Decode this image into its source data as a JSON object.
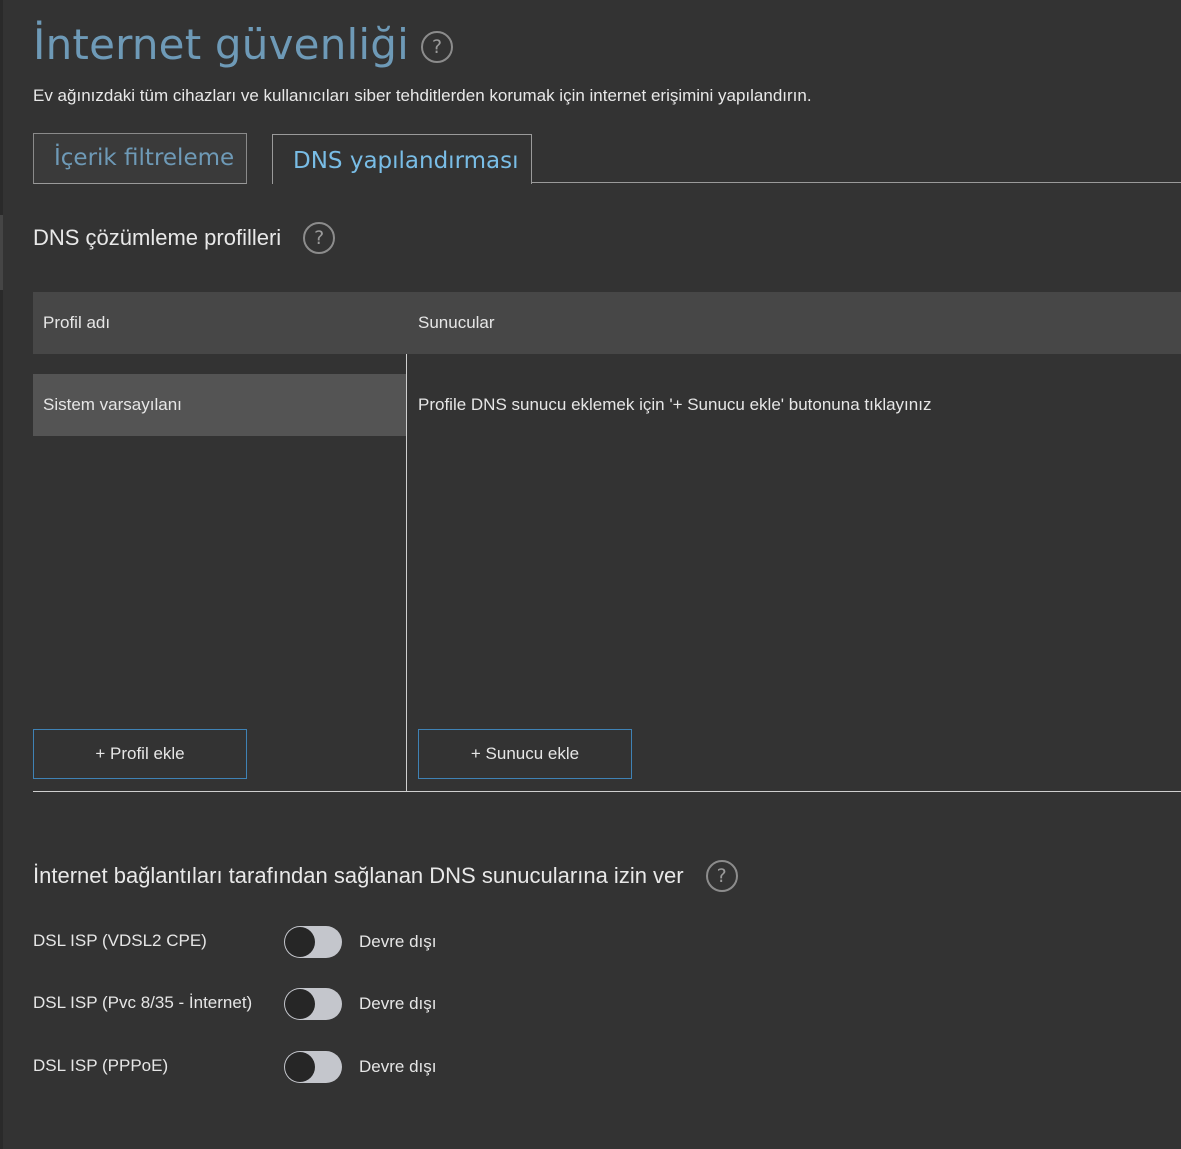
{
  "page": {
    "title": "İnternet güvenliği",
    "subtitle": "Ev ağınızdaki tüm cihazları ve kullanıcıları siber tehditlerden korumak için internet erişimini yapılandırın.",
    "help_glyph": "?"
  },
  "tabs": [
    {
      "label": "İçerik filtreleme",
      "active": false
    },
    {
      "label": "DNS yapılandırması",
      "active": true
    }
  ],
  "dns_profiles": {
    "title": "DNS çözümleme profilleri",
    "columns": [
      "Profil adı",
      "Sunucular"
    ],
    "profiles": [
      {
        "name": "Sistem varsayılanı",
        "selected": true
      }
    ],
    "servers_hint": "Profile DNS sunucu eklemek için '+ Sunucu ekle' butonuna tıklayınız",
    "add_profile_label": "+ Profil ekle",
    "add_server_label": "+ Sunucu ekle"
  },
  "isp_dns": {
    "title": "İnternet bağlantıları tarafından sağlanan DNS sunucularına izin ver",
    "connections": [
      {
        "label": "DSL ISP (VDSL2 CPE)",
        "state": "Devre dışı",
        "enabled": false
      },
      {
        "label": "DSL ISP (Pvc 8/35 - İnternet)",
        "state": "Devre dışı",
        "enabled": false
      },
      {
        "label": "DSL ISP (PPPoE)",
        "state": "Devre dışı",
        "enabled": false
      }
    ]
  },
  "colors": {
    "background": "#333333",
    "title_blue": "#6e9ab7",
    "active_tab_blue": "#79bde6",
    "button_border": "#3f82b5",
    "toggle_track": "#c4c6cc"
  }
}
